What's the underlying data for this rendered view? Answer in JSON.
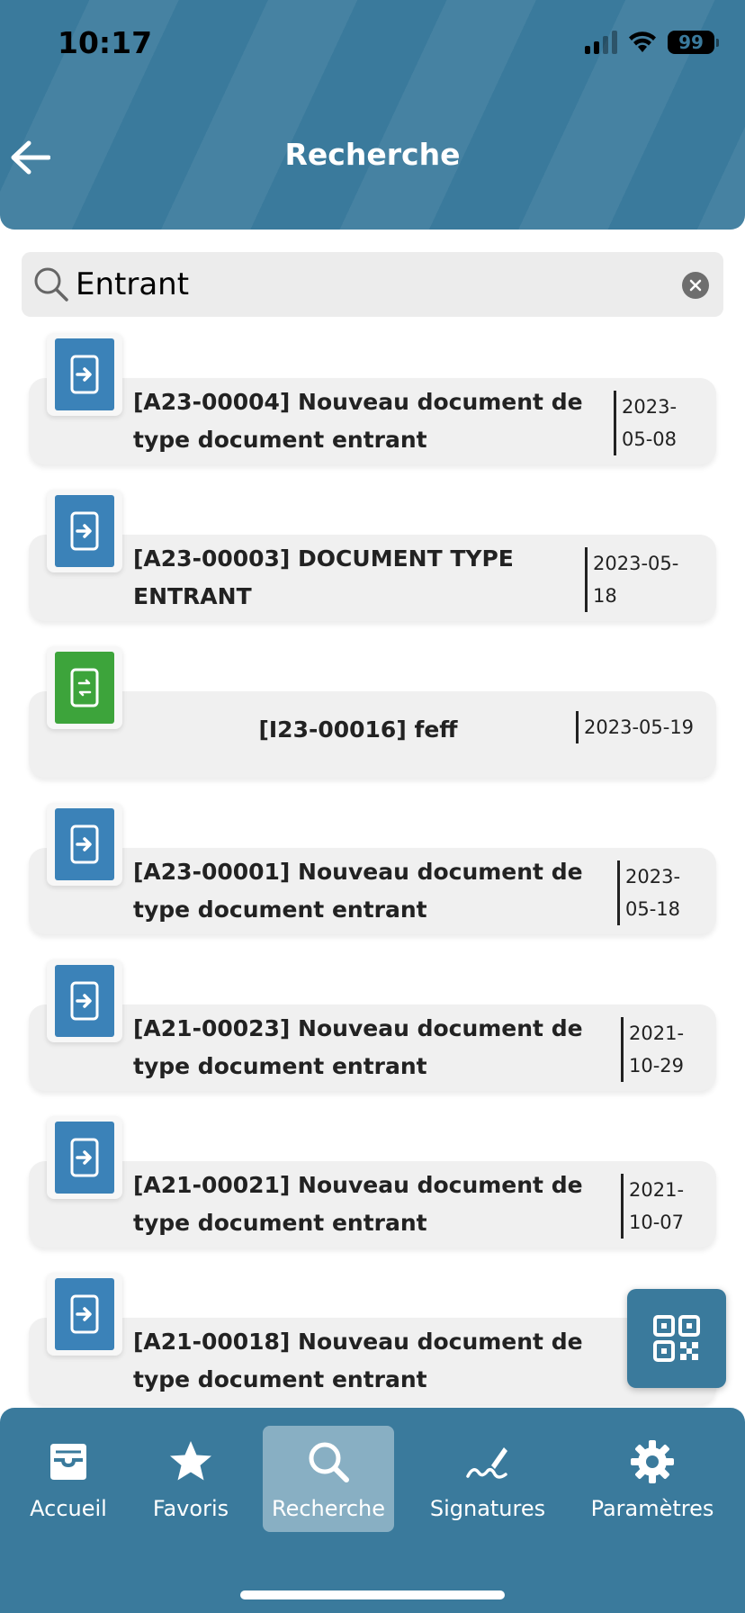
{
  "status_bar": {
    "time": "10:17",
    "battery": "99"
  },
  "header": {
    "title": "Recherche"
  },
  "search": {
    "value": "Entrant"
  },
  "results": [
    {
      "title": "[A23-00004] Nouveau document de type document entrant",
      "date_line1": "2023-",
      "date_line2": "05-08",
      "icon_color": "blue"
    },
    {
      "title": "[A23-00003] DOCUMENT TYPE ENTRANT",
      "date_line1": "2023-05-",
      "date_line2": "18",
      "icon_color": "blue"
    },
    {
      "title": "[I23-00016] feff",
      "date_line1": "2023-05-19",
      "date_line2": "",
      "icon_color": "green"
    },
    {
      "title": "[A23-00001] Nouveau document de type document entrant",
      "date_line1": "2023-",
      "date_line2": "05-18",
      "icon_color": "blue"
    },
    {
      "title": "[A21-00023] Nouveau document de type document entrant",
      "date_line1": "2021-",
      "date_line2": "10-29",
      "icon_color": "blue"
    },
    {
      "title": "[A21-00021] Nouveau document de type document entrant",
      "date_line1": "2021-",
      "date_line2": "10-07",
      "icon_color": "blue"
    },
    {
      "title": "[A21-00018] Nouveau document de type document entrant",
      "date_line1": "",
      "date_line2": "",
      "icon_color": "blue"
    }
  ],
  "tabs": [
    {
      "label": "Accueil",
      "icon": "inbox-icon"
    },
    {
      "label": "Favoris",
      "icon": "star-icon"
    },
    {
      "label": "Recherche",
      "icon": "search-icon",
      "active": true
    },
    {
      "label": "Signatures",
      "icon": "signature-pen-icon"
    },
    {
      "label": "Paramètres",
      "icon": "gear-icon"
    }
  ],
  "colors": {
    "primary": "#3a7a9c",
    "doc_blue": "#3b82b8",
    "doc_green": "#3da43b"
  }
}
